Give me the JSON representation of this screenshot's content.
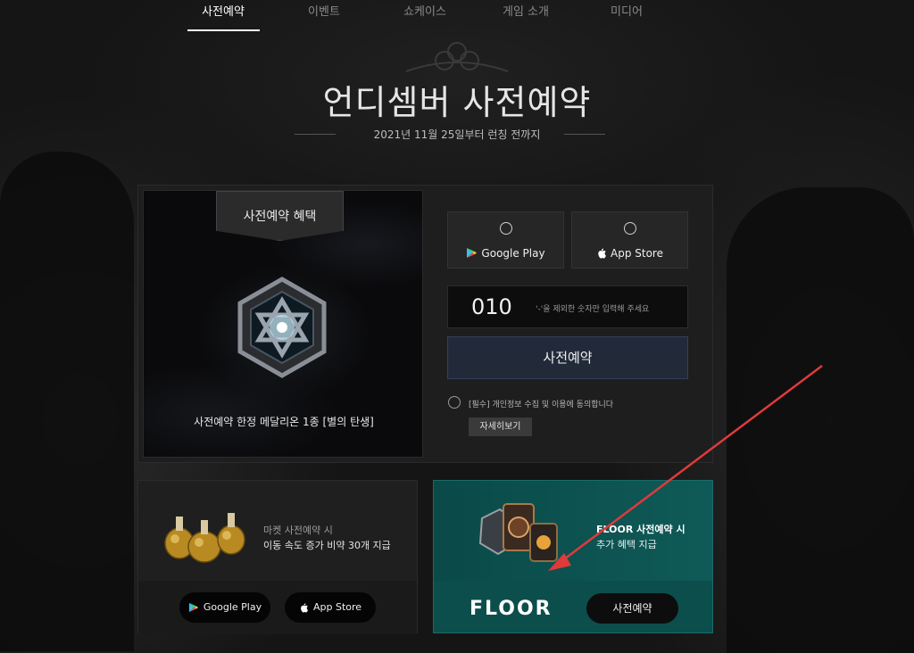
{
  "nav": {
    "items": [
      {
        "label": "사전예약",
        "active": true
      },
      {
        "label": "이벤트"
      },
      {
        "label": "쇼케이스"
      },
      {
        "label": "게임 소개"
      },
      {
        "label": "미디어"
      }
    ]
  },
  "hero": {
    "title": "언디셈버 사전예약",
    "subtitle": "2021년 11월 25일부터 런칭 전까지"
  },
  "benefit": {
    "tab_label": "사전예약 혜택",
    "caption": "사전예약 한정 메달리온 1종 [별의 탄생]"
  },
  "form": {
    "store_options": [
      {
        "label": "Google Play",
        "icon": "google-play-icon"
      },
      {
        "label": "App Store",
        "icon": "apple-icon"
      }
    ],
    "phone_prefix": "010",
    "phone_placeholder": "'-'을 제외한 숫자만 입력해 주세요",
    "reserve_button": "사전예약",
    "agree_text": "[필수] 개인정보 수집 및 이용에 동의합니다",
    "detail_button": "자세히보기"
  },
  "market": {
    "line1": "마켓 사전예약 시",
    "line2": "이동 속도 증가 비약 30개 지급",
    "google_label": "Google Play",
    "apple_label": "App Store"
  },
  "floor": {
    "line1": "FLOOR 사전예약 시",
    "line2": "추가 혜택 지급",
    "logo": "FLOOR",
    "button": "사전예약"
  },
  "colors": {
    "floor_teal": "#0f5a58",
    "reserve_navy": "#222a3a",
    "annotation_arrow": "#e03a3a"
  }
}
